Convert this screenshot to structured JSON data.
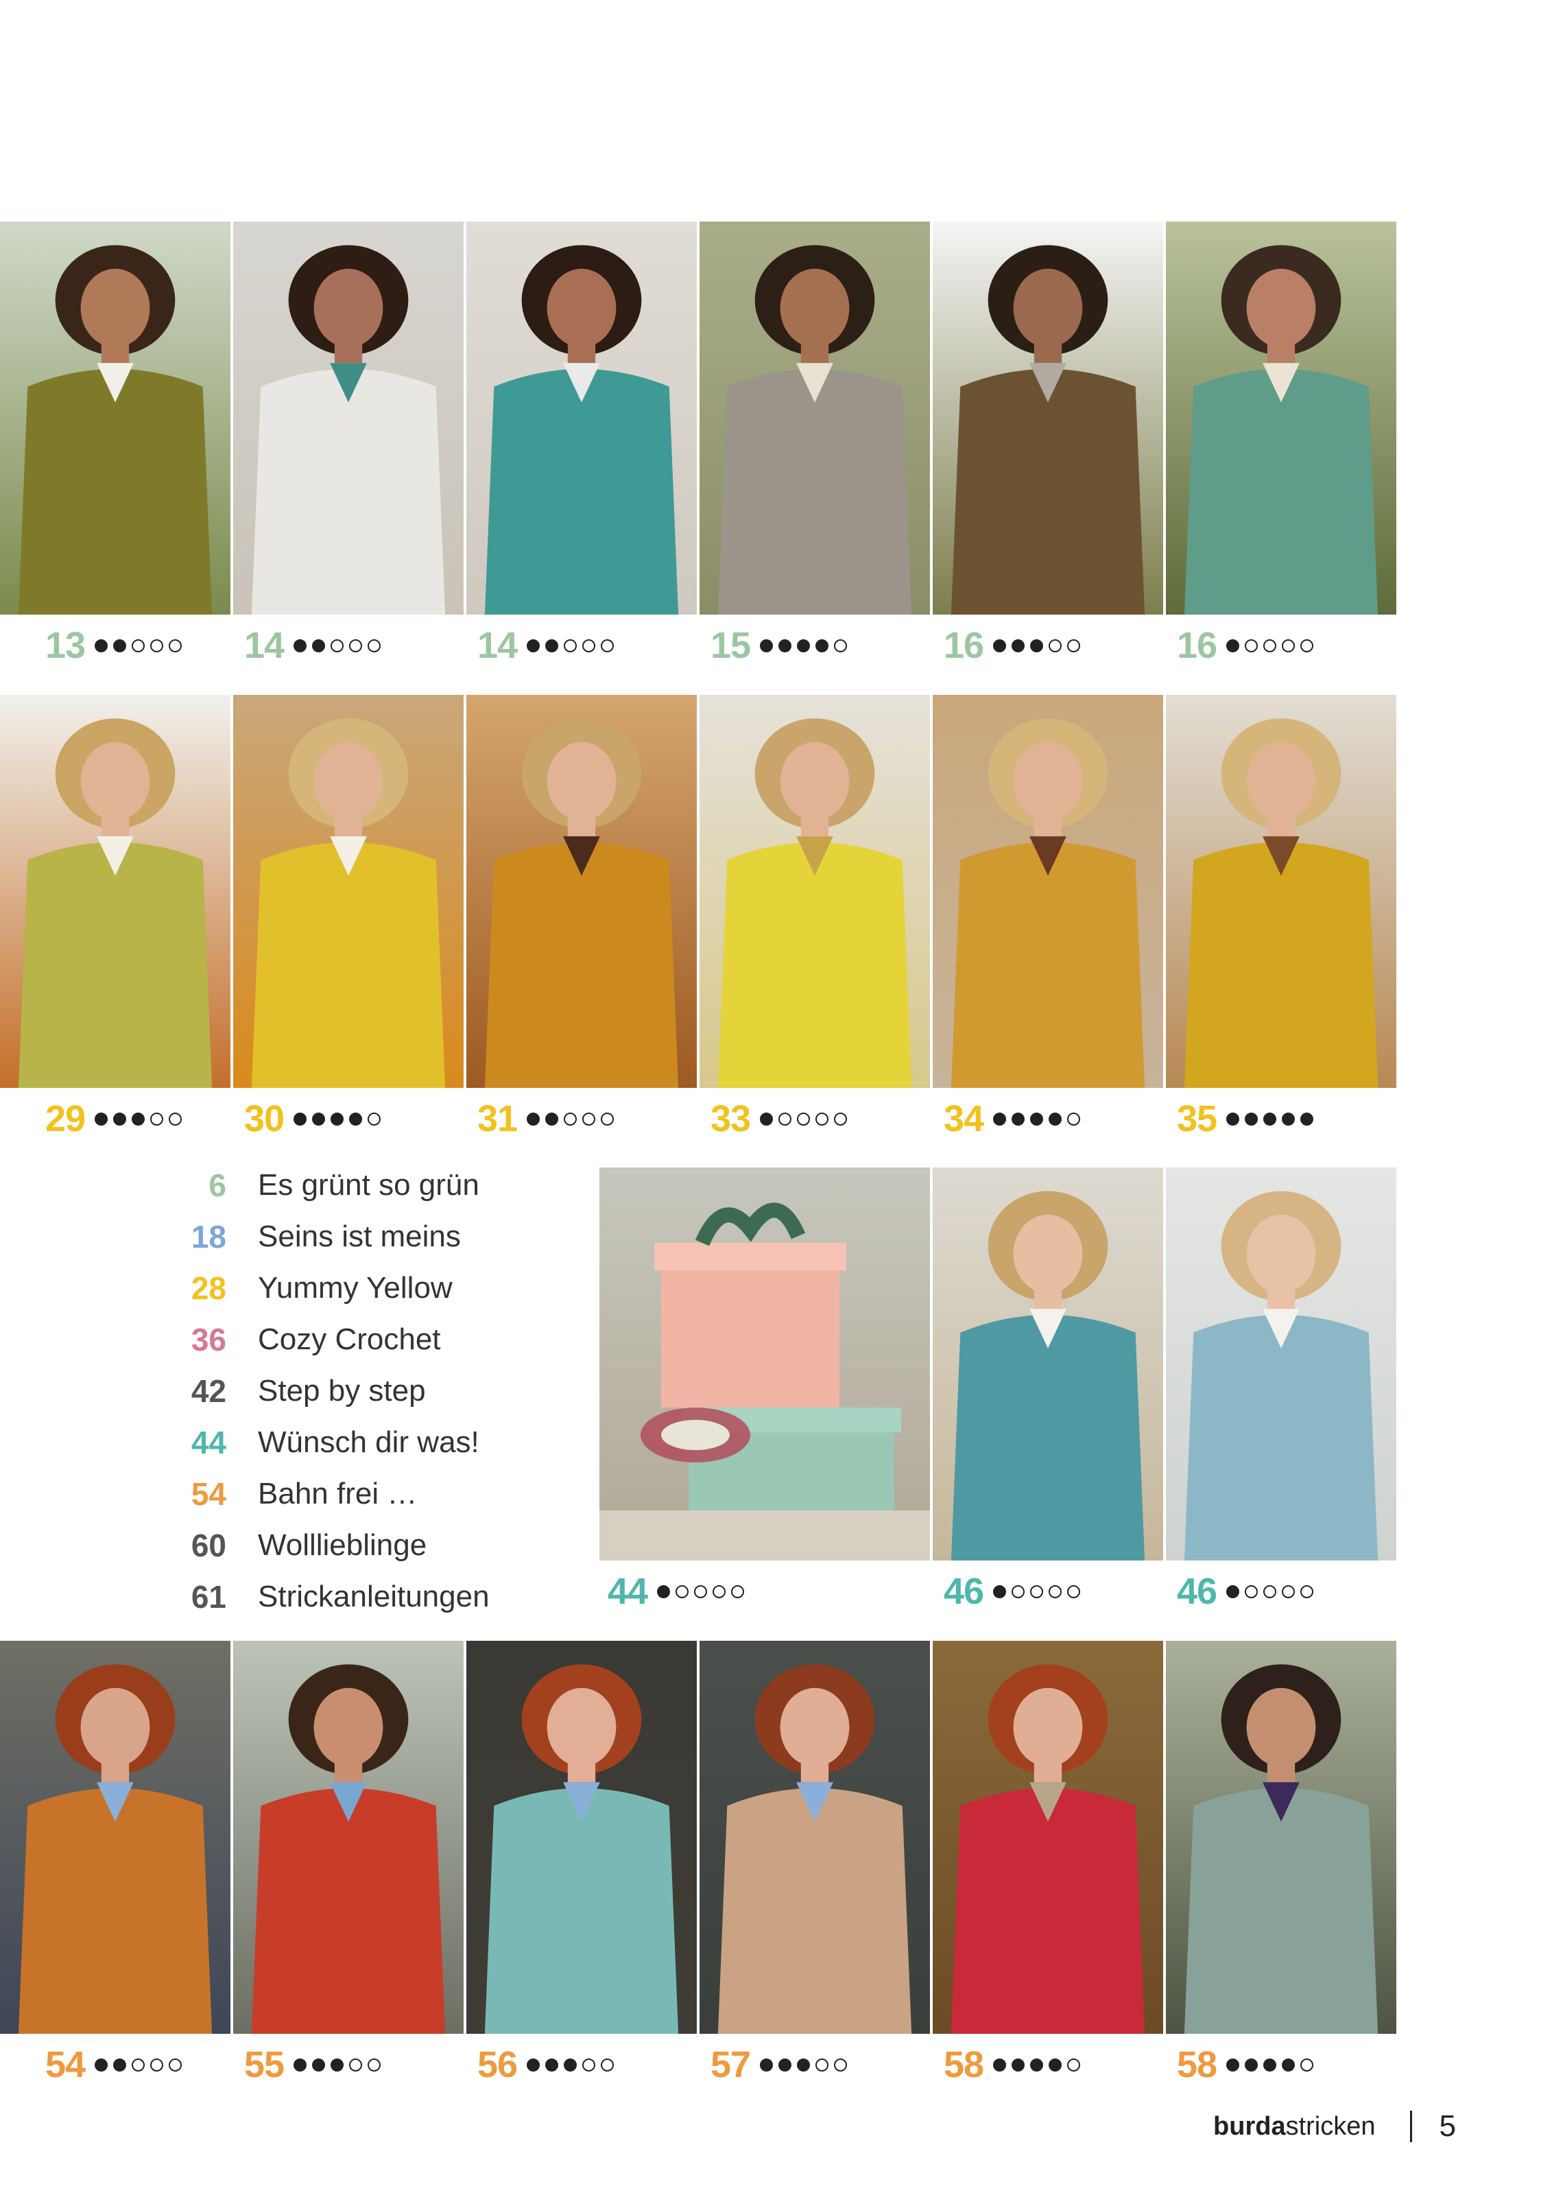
{
  "colors": {
    "green": "#9cc6a1",
    "blue": "#7ea6d6",
    "yellow": "#f2c21c",
    "pink": "#d67894",
    "gray": "#555555",
    "teal": "#4fb7ac",
    "orange": "#ef9a3e"
  },
  "rows": [
    {
      "row_id": "row-1",
      "items": [
        {
          "page": "13",
          "difficulty": 2,
          "color": "green",
          "photo": "woman-green-hat-lamb"
        },
        {
          "page": "14",
          "difficulty": 2,
          "color": "green",
          "photo": "woman-teal-wristwarmers"
        },
        {
          "page": "14",
          "difficulty": 2,
          "color": "green",
          "photo": "woman-teal-cowl"
        },
        {
          "page": "15",
          "difficulty": 4,
          "color": "green",
          "photo": "woman-grey-cardigan"
        },
        {
          "page": "16",
          "difficulty": 3,
          "color": "green",
          "photo": "woman-long-brown-vest"
        },
        {
          "page": "16",
          "difficulty": 1,
          "color": "green",
          "photo": "woman-green-vest-bucket-hat"
        }
      ]
    },
    {
      "row_id": "row-2",
      "items": [
        {
          "page": "29",
          "difficulty": 3,
          "color": "yellow",
          "photo": "woman-lime-cardigan"
        },
        {
          "page": "30",
          "difficulty": 4,
          "color": "yellow",
          "photo": "woman-yellow-cable-sweater"
        },
        {
          "page": "31",
          "difficulty": 2,
          "color": "yellow",
          "photo": "woman-mustard-jacket-hat"
        },
        {
          "page": "33",
          "difficulty": 1,
          "color": "yellow",
          "photo": "woman-striped-shawl"
        },
        {
          "page": "34",
          "difficulty": 4,
          "color": "yellow",
          "photo": "woman-mohair-sweater"
        },
        {
          "page": "35",
          "difficulty": 5,
          "color": "yellow",
          "photo": "woman-cable-polo-sweater"
        }
      ]
    },
    {
      "row_id": "row-3",
      "items": [
        {
          "page": "44",
          "difficulty": 1,
          "color": "teal",
          "photo": "gift-boxes-crochet"
        },
        {
          "page": "46",
          "difficulty": 1,
          "color": "teal",
          "photo": "woman-teal-scarf"
        },
        {
          "page": "46",
          "difficulty": 1,
          "color": "teal",
          "photo": "woman-mohair-mittens"
        }
      ]
    },
    {
      "row_id": "row-4",
      "items": [
        {
          "page": "54",
          "difficulty": 2,
          "color": "orange",
          "photo": "woman-rust-sweater"
        },
        {
          "page": "55",
          "difficulty": 3,
          "color": "orange",
          "photo": "man-red-sweater"
        },
        {
          "page": "56",
          "difficulty": 3,
          "color": "orange",
          "photo": "woman-mint-raglan"
        },
        {
          "page": "57",
          "difficulty": 3,
          "color": "orange",
          "photo": "woman-beige-knit-dress"
        },
        {
          "page": "58",
          "difficulty": 4,
          "color": "orange",
          "photo": "woman-red-sweater"
        },
        {
          "page": "58",
          "difficulty": 4,
          "color": "orange",
          "photo": "man-sage-cardigan"
        }
      ]
    }
  ],
  "toc": [
    {
      "page": "6",
      "title": "Es grünt so grün",
      "color": "green"
    },
    {
      "page": "18",
      "title": "Seins ist meins",
      "color": "blue"
    },
    {
      "page": "28",
      "title": "Yummy Yellow",
      "color": "yellow"
    },
    {
      "page": "36",
      "title": "Cozy Crochet",
      "color": "pink"
    },
    {
      "page": "42",
      "title": "Step by step",
      "color": "gray"
    },
    {
      "page": "44",
      "title": "Wünsch dir was!",
      "color": "teal"
    },
    {
      "page": "54",
      "title": "Bahn frei …",
      "color": "orange"
    },
    {
      "page": "60",
      "title": "Wolllieblinge",
      "color": "gray"
    },
    {
      "page": "61",
      "title": "Strickanleitungen",
      "color": "gray"
    }
  ],
  "footer": {
    "brand_bold": "burda",
    "brand_light": "stricken",
    "page_number": "5"
  }
}
